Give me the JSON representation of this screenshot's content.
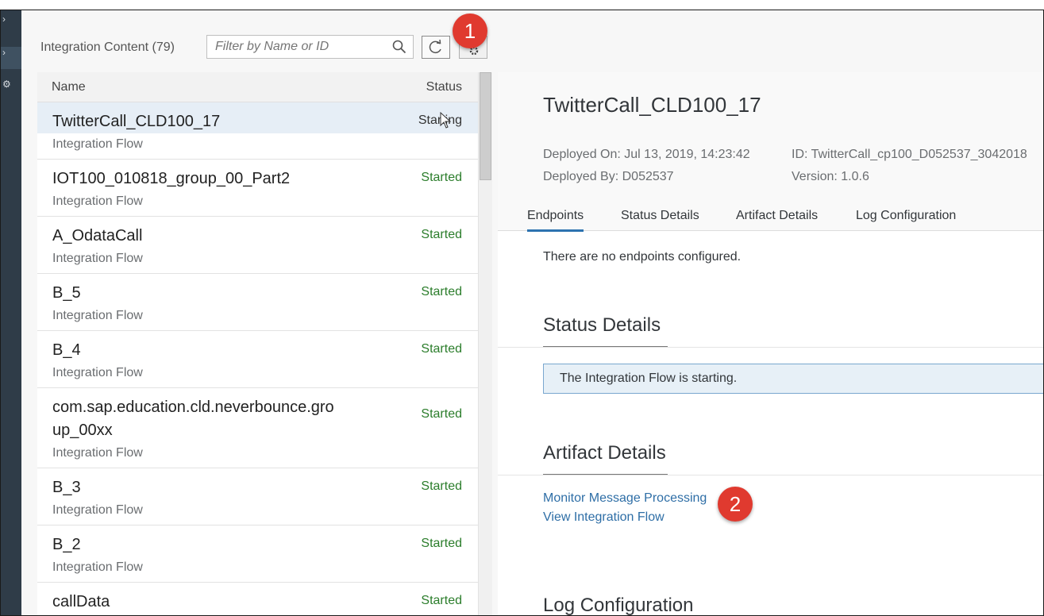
{
  "nav": {
    "items": [
      "›",
      "›",
      "⚙"
    ]
  },
  "master": {
    "title": "Integration Content (79)",
    "search_placeholder": "Filter by Name or ID",
    "columns": {
      "name": "Name",
      "status": "Status"
    },
    "rows": [
      {
        "name": "TwitterCall_CLD100_17",
        "type": "Integration Flow",
        "status": "Starting",
        "selected": true
      },
      {
        "name": "IOT100_010818_group_00_Part2",
        "type": "Integration Flow",
        "status": "Started"
      },
      {
        "name": "A_OdataCall",
        "type": "Integration Flow",
        "status": "Started"
      },
      {
        "name": "B_5",
        "type": "Integration Flow",
        "status": "Started"
      },
      {
        "name": "B_4",
        "type": "Integration Flow",
        "status": "Started"
      },
      {
        "name": "com.sap.education.cld.neverbounce.gro up_00xx",
        "type": "Integration Flow",
        "status": "Started"
      },
      {
        "name": "B_3",
        "type": "Integration Flow",
        "status": "Started"
      },
      {
        "name": "B_2",
        "type": "Integration Flow",
        "status": "Started"
      },
      {
        "name": "callData",
        "type": "Integration Flow",
        "status": "Started"
      }
    ]
  },
  "callouts": {
    "one": "1",
    "two": "2"
  },
  "detail": {
    "title": "TwitterCall_CLD100_17",
    "deployed_on": "Deployed On: Jul 13, 2019, 14:23:42",
    "deployed_by": "Deployed By: D052537",
    "id": "ID: TwitterCall_cp100_D052537_3042018",
    "version": "Version: 1.0.6",
    "tabs": [
      "Endpoints",
      "Status Details",
      "Artifact Details",
      "Log Configuration"
    ],
    "no_endpoints": "There are no endpoints configured.",
    "status_section": "Status Details",
    "status_message": "The Integration Flow is starting.",
    "artifact_section": "Artifact Details",
    "links": [
      "Monitor Message Processing",
      "View Integration Flow"
    ],
    "log_section": "Log Configuration"
  },
  "colors": {
    "started": "#2b7d2b",
    "link": "#2e6ea6",
    "tab_active": "#2d73b0",
    "callout": "#e03a2f",
    "nav": "#2f3c48"
  }
}
